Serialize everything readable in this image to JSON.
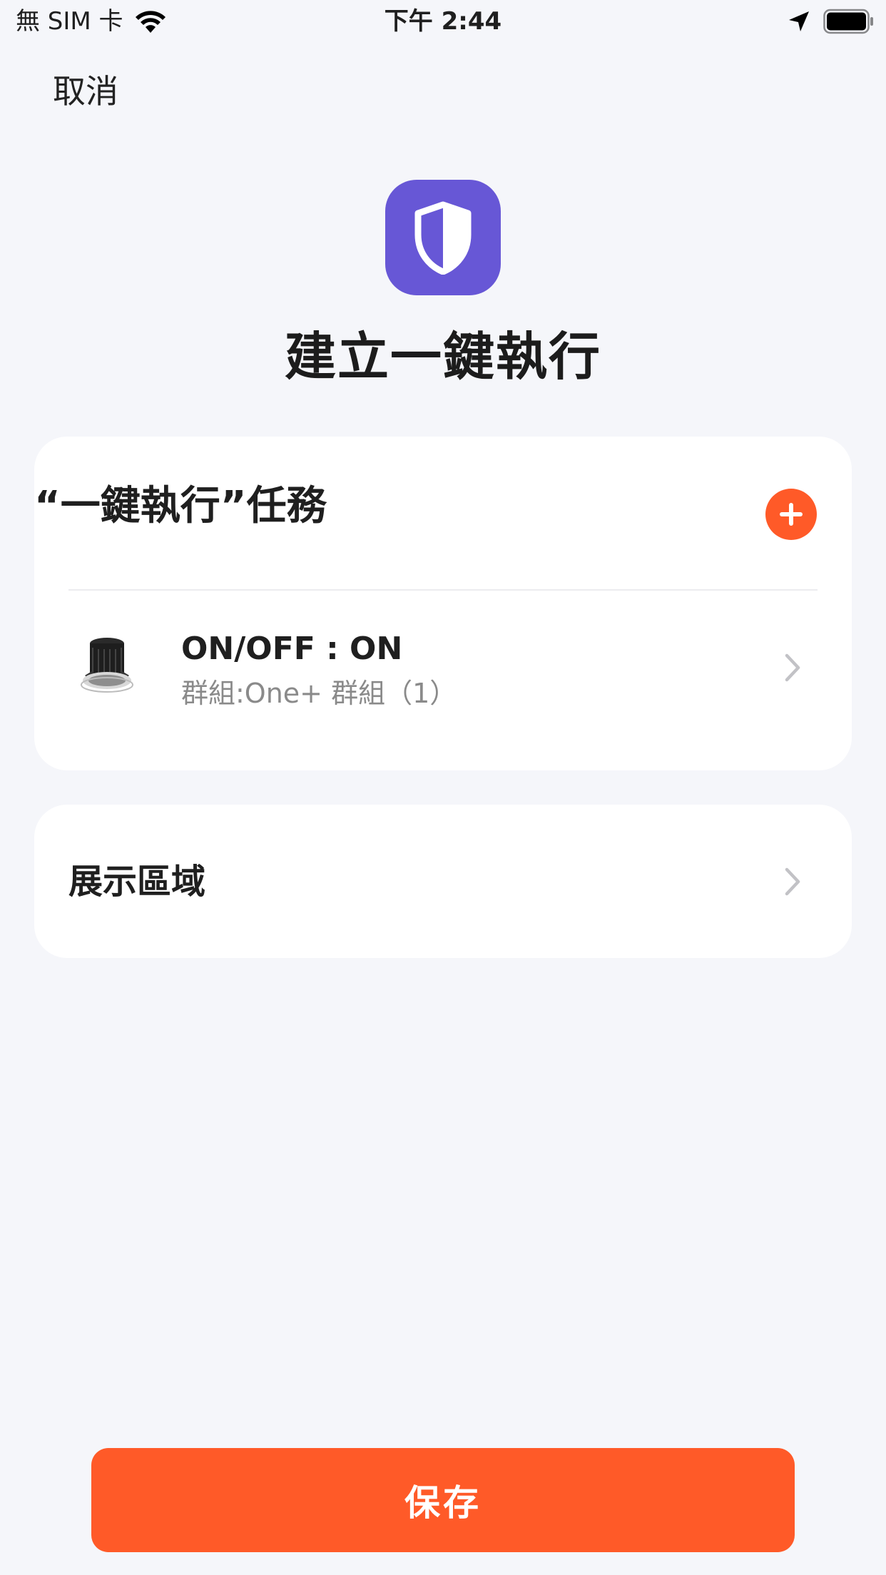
{
  "status_bar": {
    "carrier": "無 SIM 卡",
    "time": "下午 2:44"
  },
  "nav": {
    "cancel_label": "取消"
  },
  "header": {
    "icon": "shield-icon",
    "accent_color": "#6757d6",
    "title": "建立一鍵執行"
  },
  "tasks_section": {
    "title": "“一鍵執行”任務",
    "add_icon": "plus-icon",
    "add_color": "#ff5a28",
    "items": [
      {
        "title": "ON/OFF : ON",
        "subtitle": "群組:One+ 群組（1）",
        "thumbnail": "downlight-device-image"
      }
    ]
  },
  "display_area": {
    "label": "展示區域"
  },
  "footer": {
    "save_label": "保存",
    "save_color": "#ff5a28"
  }
}
